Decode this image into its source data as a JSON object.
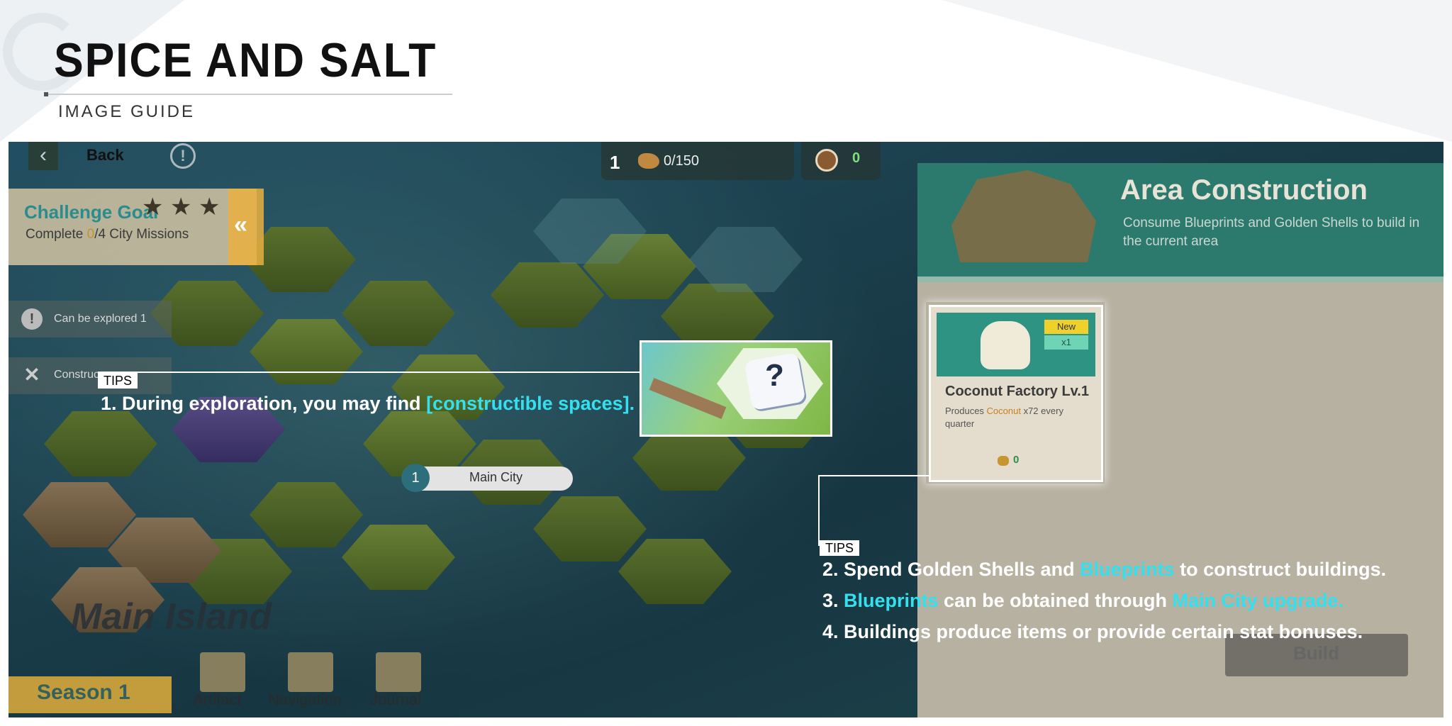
{
  "header": {
    "title": "SPICE AND SALT",
    "subtitle": "IMAGE GUIDE"
  },
  "hud": {
    "back_label": "Back",
    "resource_level": "1",
    "resource_count": "0/150",
    "coconut_count": "0"
  },
  "challenge": {
    "title": "Challenge Goal",
    "text_prefix": "Complete ",
    "progress": "0",
    "text_suffix": "/4 City Missions",
    "stars": 3
  },
  "side": {
    "explore_label": "Can be explored 1",
    "construct_label": "Construc"
  },
  "map": {
    "city_number": "1",
    "city_label": "Main City",
    "island_label": "Main Island",
    "season_label": "Season 1",
    "bottom_buttons": [
      "Artifact",
      "Navigation",
      "Journal"
    ]
  },
  "tips": {
    "tag": "TIPS",
    "tip1_prefix": "1. During exploration, you may find ",
    "tip1_highlight": "[constructible spaces].",
    "tip2_prefix": "2. Spend Golden Shells and ",
    "tip2_highlight": "Blueprints",
    "tip2_suffix": " to construct buildings.",
    "tip3_num": "3. ",
    "tip3_highlight1": "Blueprints",
    "tip3_mid": " can be obtained through ",
    "tip3_highlight2": "Main City upgrade.",
    "tip4": "4. Buildings produce items or provide certain stat bonuses."
  },
  "panel": {
    "title": "Area Construction",
    "description": "Consume Blueprints and Golden Shells to build in the current area",
    "build_label": "Build",
    "card": {
      "badge_new": "New",
      "badge_count": "x1",
      "name": "Coconut Factory Lv.1",
      "desc_prefix": "Produces ",
      "desc_highlight": "Coconut",
      "desc_suffix": " x72 every quarter",
      "cost": "0"
    }
  },
  "colors": {
    "highlight_cyan": "#34e0ee",
    "panel_teal": "#2c7a6d"
  }
}
